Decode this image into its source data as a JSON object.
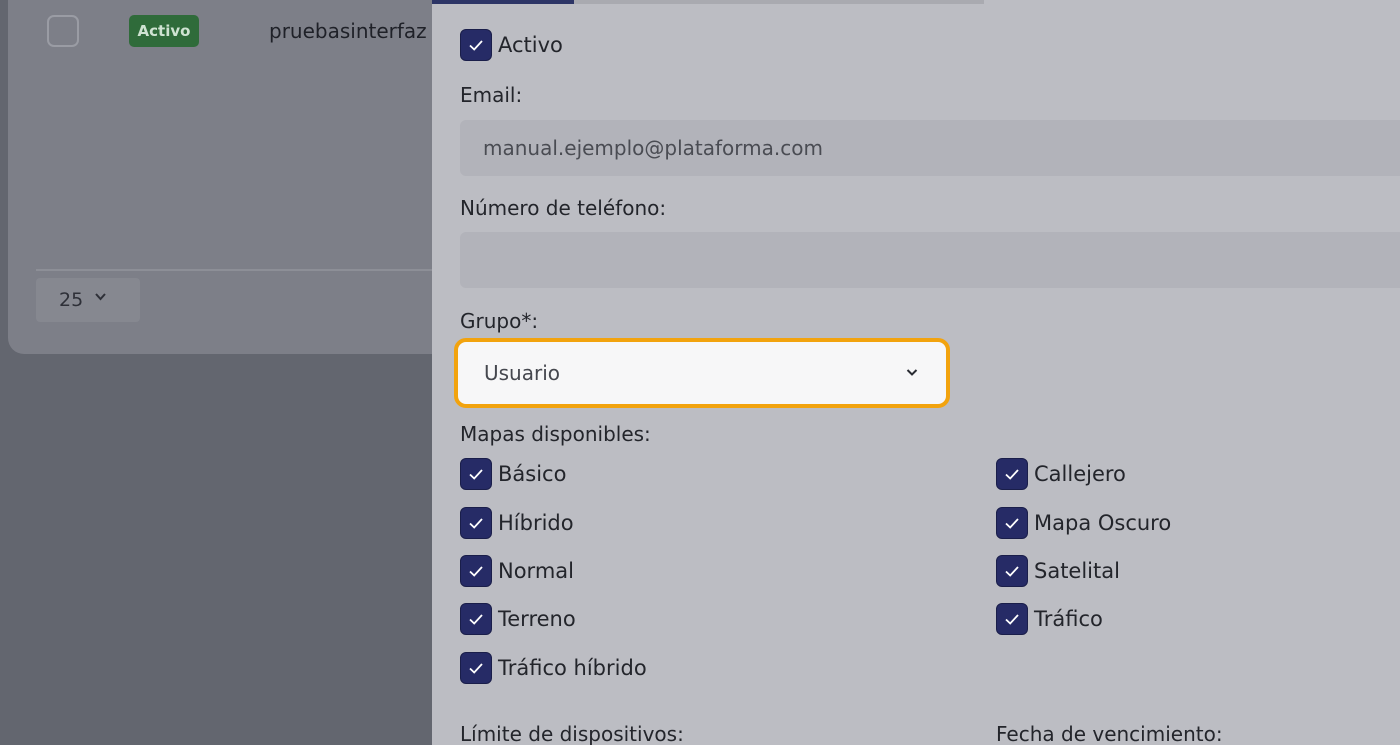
{
  "background": {
    "row": {
      "status_badge": "Activo",
      "user": "pruebasinterfaz"
    },
    "pagination": {
      "page_size": "25"
    },
    "colors": {
      "badge": "#2f6b3a",
      "overlay": "#63666f"
    }
  },
  "drawer": {
    "active": {
      "label": "Activo",
      "checked": true
    },
    "email": {
      "label": "Email:",
      "value": "manual.ejemplo@plataforma.com"
    },
    "phone": {
      "label": "Número de teléfono:",
      "value": ""
    },
    "group": {
      "label": "Grupo*:",
      "value": "Usuario"
    },
    "maps": {
      "label": "Mapas disponibles:",
      "items": [
        {
          "label": "Básico",
          "checked": true
        },
        {
          "label": "Callejero",
          "checked": true
        },
        {
          "label": "Híbrido",
          "checked": true
        },
        {
          "label": "Mapa Oscuro",
          "checked": true
        },
        {
          "label": "Normal",
          "checked": true
        },
        {
          "label": "Satelital",
          "checked": true
        },
        {
          "label": "Terreno",
          "checked": true
        },
        {
          "label": "Tráfico",
          "checked": true
        },
        {
          "label": "Tráfico híbrido",
          "checked": true
        }
      ]
    },
    "device_limit": {
      "label": "Límite de dispositivos:"
    },
    "expiry_date": {
      "label": "Fecha de vencimiento:"
    },
    "colors": {
      "checkbox": "#262b66",
      "focus_ring": "#f2a30e",
      "panel": "#bcbdc3"
    }
  }
}
